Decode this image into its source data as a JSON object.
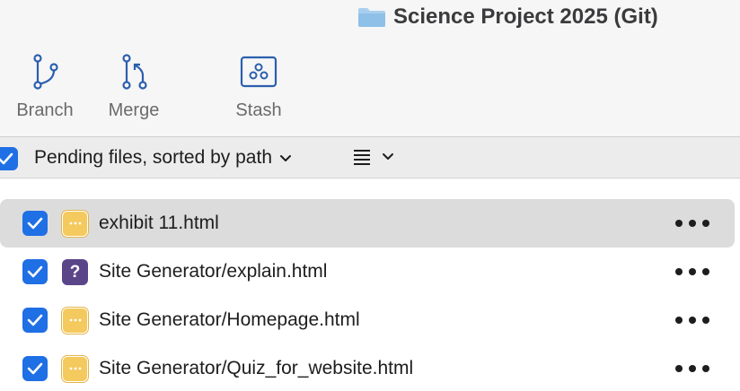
{
  "window": {
    "repo_title": "Science Project 2025 (Git)",
    "folder_icon": "folder-icon"
  },
  "toolbar": {
    "buttons": [
      {
        "label": "Branch",
        "icon": "branch-icon"
      },
      {
        "label": "Merge",
        "icon": "merge-icon"
      },
      {
        "label": "Stash",
        "icon": "stash-icon"
      }
    ]
  },
  "filter_bar": {
    "all_checked": true,
    "label": "Pending files, sorted by path",
    "view_icon": "list-view-icon"
  },
  "files": [
    {
      "name": "exhibit 11.html",
      "checked": true,
      "status": "modified",
      "selected": true
    },
    {
      "name": "Site Generator/explain.html",
      "checked": true,
      "status": "untracked",
      "status_glyph": "?",
      "selected": false
    },
    {
      "name": "Site Generator/Homepage.html",
      "checked": true,
      "status": "modified",
      "selected": false
    },
    {
      "name": "Site Generator/Quiz_for_website.html",
      "checked": true,
      "status": "modified",
      "selected": false
    }
  ],
  "colors": {
    "accent": "#1f6fe5",
    "modified": "#f4c95d",
    "untracked": "#5b4589",
    "selection": "#dcdcdc",
    "icon_blue": "#2b5fae"
  }
}
